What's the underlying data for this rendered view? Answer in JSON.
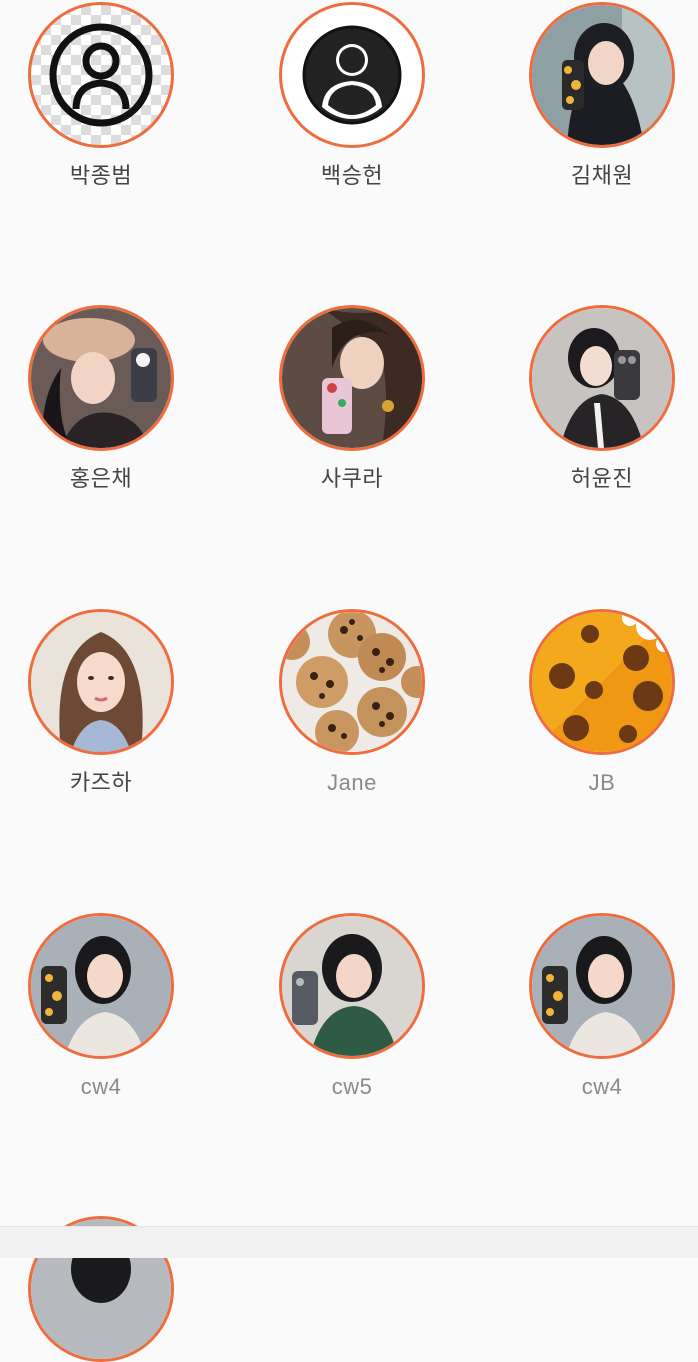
{
  "theme": {
    "accent": "#ee6c3d",
    "background": "#fafafa"
  },
  "profiles": [
    {
      "name": "박종범",
      "avatar": "default-outline",
      "avatar_icon": "user-outline-icon",
      "muted": false
    },
    {
      "name": "백승헌",
      "avatar": "default-filled",
      "avatar_icon": "user-filled-icon",
      "muted": false
    },
    {
      "name": "김채원",
      "avatar": "photo",
      "avatar_icon": "profile-photo",
      "muted": false
    },
    {
      "name": "홍은채",
      "avatar": "photo",
      "avatar_icon": "profile-photo",
      "muted": false
    },
    {
      "name": "사쿠라",
      "avatar": "photo",
      "avatar_icon": "profile-photo",
      "muted": false
    },
    {
      "name": "허윤진",
      "avatar": "photo",
      "avatar_icon": "profile-photo",
      "muted": false
    },
    {
      "name": "카즈하",
      "avatar": "photo",
      "avatar_icon": "profile-photo",
      "muted": false
    },
    {
      "name": "Jane",
      "avatar": "cookies-photo",
      "avatar_icon": "cookies-icon",
      "muted": true
    },
    {
      "name": "JB",
      "avatar": "cookie-illustration",
      "avatar_icon": "cookie-icon",
      "muted": true
    },
    {
      "name": "cw4",
      "avatar": "photo",
      "avatar_icon": "profile-photo",
      "muted": true
    },
    {
      "name": "cw5",
      "avatar": "photo",
      "avatar_icon": "profile-photo",
      "muted": true
    },
    {
      "name": "cw4",
      "avatar": "photo",
      "avatar_icon": "profile-photo",
      "muted": true
    }
  ]
}
